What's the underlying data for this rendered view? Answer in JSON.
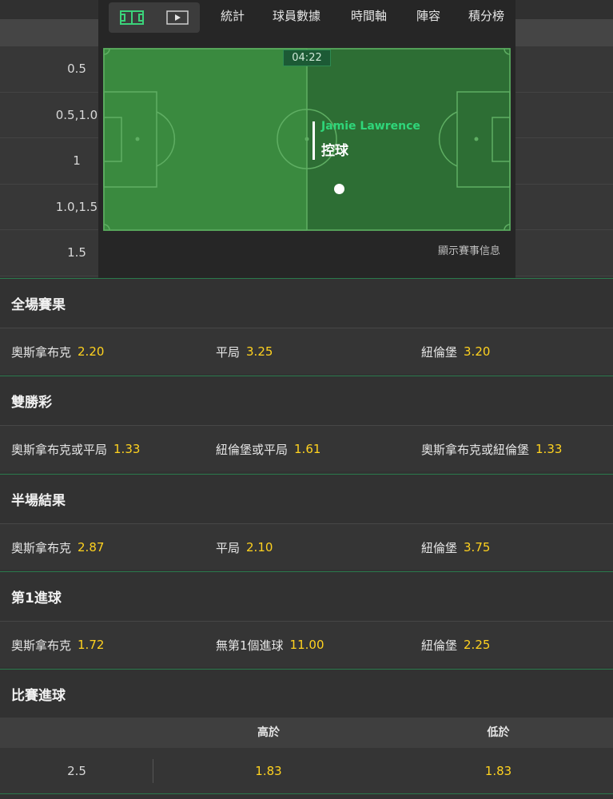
{
  "tracker": {
    "tabs": [
      "統計",
      "球員數據",
      "時間軸",
      "陣容",
      "積分榜"
    ],
    "clock": "04:22",
    "event_player": "Jamie Lawrence",
    "event_action": "控球",
    "show_info": "顯示賽事信息",
    "mode_icons": [
      "pitch-icon",
      "video-icon"
    ]
  },
  "handicap_lines": [
    "0.5",
    "0.5,1.0",
    "1",
    "1.0,1.5",
    "1.5"
  ],
  "markets": [
    {
      "title": "全場賽果",
      "selections": [
        {
          "name": "奧斯拿布克",
          "odds": "2.20"
        },
        {
          "name": "平局",
          "odds": "3.25"
        },
        {
          "name": "紐倫堡",
          "odds": "3.20"
        }
      ]
    },
    {
      "title": "雙勝彩",
      "selections": [
        {
          "name": "奧斯拿布克或平局",
          "odds": "1.33"
        },
        {
          "name": "紐倫堡或平局",
          "odds": "1.61"
        },
        {
          "name": "奧斯拿布克或紐倫堡",
          "odds": "1.33"
        }
      ]
    },
    {
      "title": "半場結果",
      "selections": [
        {
          "name": "奧斯拿布克",
          "odds": "2.87"
        },
        {
          "name": "平局",
          "odds": "2.10"
        },
        {
          "name": "紐倫堡",
          "odds": "3.75"
        }
      ]
    },
    {
      "title": "第1進球",
      "selections": [
        {
          "name": "奧斯拿布克",
          "odds": "1.72"
        },
        {
          "name": "無第1個進球",
          "odds": "11.00"
        },
        {
          "name": "紐倫堡",
          "odds": "2.25"
        }
      ]
    }
  ],
  "totals": {
    "title": "比賽進球",
    "over_label": "高於",
    "under_label": "低於",
    "line": "2.5",
    "over_odds": "1.83",
    "under_odds": "1.83"
  },
  "colors": {
    "odds": "#ffd21f",
    "accent_green": "#2fd67a",
    "pitch_light": "#3a8a3f",
    "pitch_dark": "#2d6e34"
  }
}
